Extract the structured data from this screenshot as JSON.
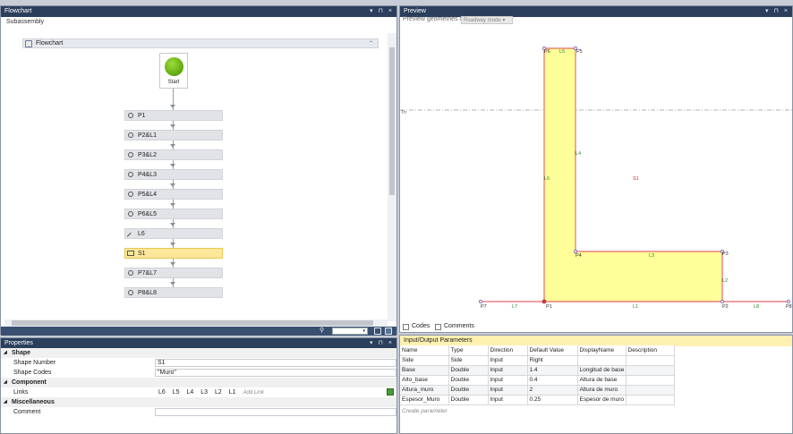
{
  "flowchart": {
    "title": "Flowchart",
    "window_controls": "▾ ⊓ ×",
    "subassembly": "Subassembly",
    "header": "Flowchart",
    "start_label": "Start",
    "nodes": [
      {
        "label": "P1",
        "icon": "point-icon"
      },
      {
        "label": "P2&L1",
        "icon": "point-icon"
      },
      {
        "label": "P3&L2",
        "icon": "point-icon"
      },
      {
        "label": "P4&L3",
        "icon": "point-icon"
      },
      {
        "label": "P5&L4",
        "icon": "point-icon"
      },
      {
        "label": "P6&L5",
        "icon": "point-icon"
      },
      {
        "label": "L6",
        "icon": "line-icon"
      },
      {
        "label": "S1",
        "icon": "shape-icon",
        "selected": true
      },
      {
        "label": "P7&L7",
        "icon": "point-icon"
      },
      {
        "label": "P8&L8",
        "icon": "point-icon"
      }
    ],
    "toolbar": {
      "zoom_icon": "⚲"
    }
  },
  "properties": {
    "title": "Properties",
    "window_controls": "▾ ⊓ ×",
    "categories": {
      "shape": "Shape",
      "component": "Component",
      "misc": "Miscellaneous"
    },
    "rows": {
      "shape_number": {
        "name": "Shape Number",
        "value": "S1"
      },
      "shape_codes": {
        "name": "Shape Codes",
        "value": "\"Muro\""
      },
      "links": {
        "name": "Links",
        "values": [
          "L6",
          "L5",
          "L4",
          "L3",
          "L2",
          "L1"
        ],
        "add": "Add Link"
      },
      "comment": {
        "name": "Comment",
        "value": ""
      }
    }
  },
  "preview": {
    "title": "Preview",
    "window_controls": "▾ ⊓ ×",
    "geom_label": "Preview geometries in",
    "geom_mode": "Roadway mode",
    "codes_label": "Codes",
    "comments_label": "Comments",
    "geometry": {
      "fill": "#ffff99",
      "outline": "#e0404a",
      "labels": {
        "P1": "P1",
        "P2": "P2",
        "P3": "P3",
        "P4": "P4",
        "P5": "P5",
        "P6": "P6",
        "P7": "P7",
        "P8": "P8",
        "L1": "L1",
        "L2": "L2",
        "L3": "L3",
        "L4": "L4",
        "L5": "L5",
        "L6": "L6",
        "L7": "L7",
        "L8": "L8",
        "S1": "S1",
        "ref": "Tn"
      }
    }
  },
  "io": {
    "title": "Input/Output Parameters",
    "columns": [
      "Name",
      "Type",
      "Direction",
      "Default Value",
      "DisplayName",
      "Description"
    ],
    "rows": [
      [
        "Side",
        "Side",
        "Input",
        "Right",
        "",
        ""
      ],
      [
        "Base",
        "Double",
        "Input",
        "1.4",
        "Longitud de base",
        ""
      ],
      [
        "Alto_base",
        "Double",
        "Input",
        "0.4",
        "Altura de base",
        ""
      ],
      [
        "Altura_muro",
        "Double",
        "Input",
        "2",
        "Altura de muro",
        ""
      ],
      [
        "Espesor_Muro",
        "Double",
        "Input",
        "0.25",
        "Espesor de muro",
        ""
      ]
    ],
    "create": "Create parameter"
  }
}
